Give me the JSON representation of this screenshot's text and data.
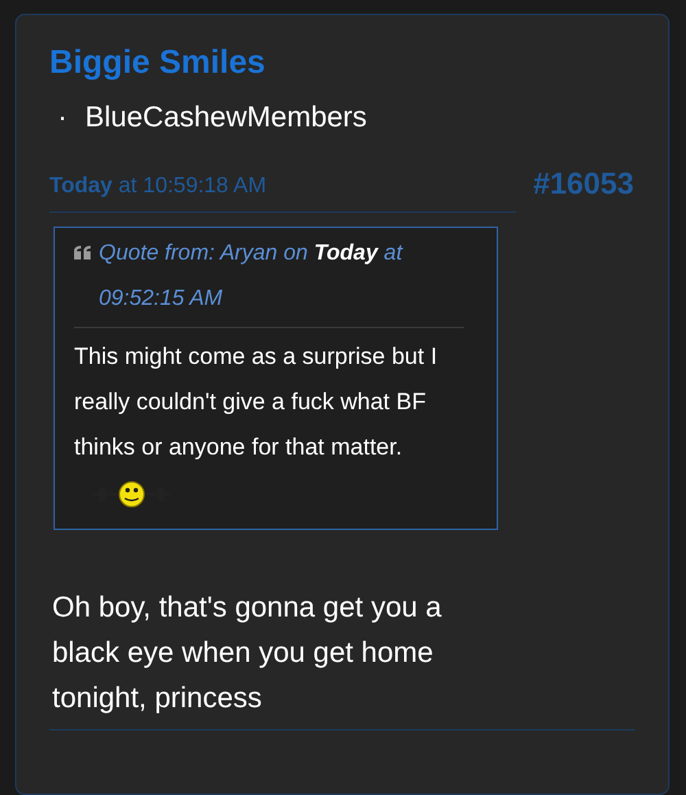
{
  "post": {
    "author": "Biggie Smiles",
    "group_bullet": "·",
    "group": "BlueCashewMembers",
    "date": "**Today** at 10:59:18 AM",
    "number": "#16053",
    "quote": {
      "header": "Quote from: Aryan on **Today** at 09:52:15 AM",
      "text": "This might come as a surprise but I really couldn't give a fuck what BF thinks or anyone for that matter."
    },
    "body": "Oh boy, that's gonna get you a black eye when you get home tonight, princess"
  }
}
